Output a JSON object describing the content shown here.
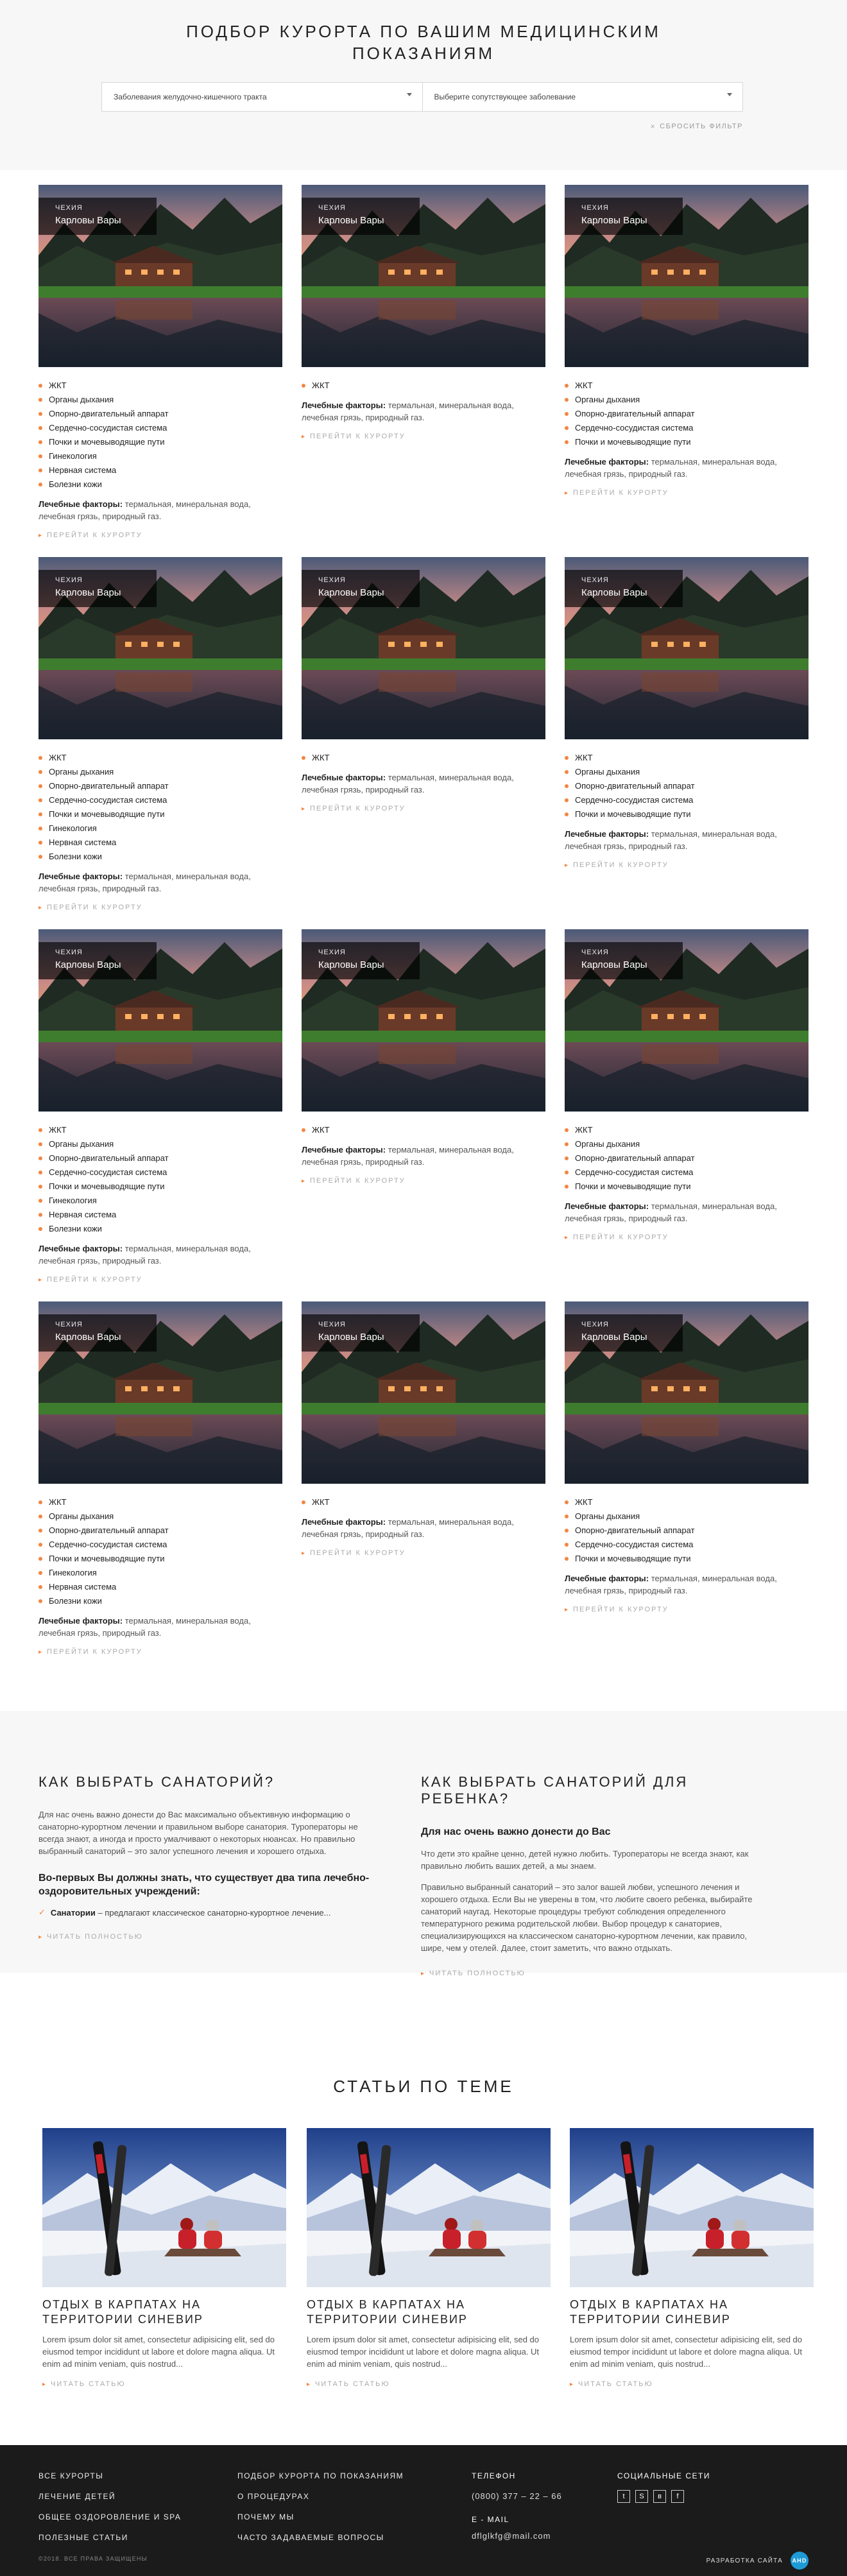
{
  "hero": {
    "title": "ПОДБОР КУРОРТА ПО ВАШИМ МЕДИЦИНСКИМ ПОКАЗАНИЯМ",
    "filter1": "Заболевания желудочно-кишечного тракта",
    "filter2": "Выберите сопутствующее заболевание",
    "reset": "СБРОСИТЬ ФИЛЬТР"
  },
  "cards": [
    {
      "country": "ЧЕХИЯ",
      "name": "Карловы Вары",
      "items": [
        "ЖКТ",
        "Органы дыхания",
        "Опорно-двигательный аппарат",
        "Сердечно-сосудистая система",
        "Почки и мочевыводящие пути",
        "Гинекология",
        "Нервная система",
        "Болезни кожи"
      ],
      "factors_label": "Лечебные факторы:",
      "factors": "термальная, минеральная вода, лечебная грязь, природный газ.",
      "link": "ПЕРЕЙТИ К КУРОРТУ"
    },
    {
      "country": "ЧЕХИЯ",
      "name": "Карловы Вары",
      "items": [
        "ЖКТ"
      ],
      "factors_label": "Лечебные факторы:",
      "factors": "термальная, минеральная вода, лечебная грязь, природный газ.",
      "link": "ПЕРЕЙТИ К КУРОРТУ"
    },
    {
      "country": "ЧЕХИЯ",
      "name": "Карловы Вары",
      "items": [
        "ЖКТ",
        "Органы дыхания",
        "Опорно-двигательный аппарат",
        "Сердечно-сосудистая система",
        "Почки и мочевыводящие пути"
      ],
      "factors_label": "Лечебные факторы:",
      "factors": "термальная, минеральная вода, лечебная грязь, природный газ.",
      "link": "ПЕРЕЙТИ К КУРОРТУ"
    },
    {
      "country": "ЧЕХИЯ",
      "name": "Карловы Вары",
      "items": [
        "ЖКТ",
        "Органы дыхания",
        "Опорно-двигательный аппарат",
        "Сердечно-сосудистая система",
        "Почки и мочевыводящие пути",
        "Гинекология",
        "Нервная система",
        "Болезни кожи"
      ],
      "factors_label": "Лечебные факторы:",
      "factors": "термальная, минеральная вода, лечебная грязь, природный газ.",
      "link": "ПЕРЕЙТИ К КУРОРТУ"
    },
    {
      "country": "ЧЕХИЯ",
      "name": "Карловы Вары",
      "items": [
        "ЖКТ"
      ],
      "factors_label": "Лечебные факторы:",
      "factors": "термальная, минеральная вода, лечебная грязь, природный газ.",
      "link": "ПЕРЕЙТИ К КУРОРТУ"
    },
    {
      "country": "ЧЕХИЯ",
      "name": "Карловы Вары",
      "items": [
        "ЖКТ",
        "Органы дыхания",
        "Опорно-двигательный аппарат",
        "Сердечно-сосудистая система",
        "Почки и мочевыводящие пути"
      ],
      "factors_label": "Лечебные факторы:",
      "factors": "термальная, минеральная вода, лечебная грязь, природный газ.",
      "link": "ПЕРЕЙТИ К КУРОРТУ"
    },
    {
      "country": "ЧЕХИЯ",
      "name": "Карловы Вары",
      "items": [
        "ЖКТ",
        "Органы дыхания",
        "Опорно-двигательный аппарат",
        "Сердечно-сосудистая система",
        "Почки и мочевыводящие пути",
        "Гинекология",
        "Нервная система",
        "Болезни кожи"
      ],
      "factors_label": "Лечебные факторы:",
      "factors": "термальная, минеральная вода, лечебная грязь, природный газ.",
      "link": "ПЕРЕЙТИ К КУРОРТУ"
    },
    {
      "country": "ЧЕХИЯ",
      "name": "Карловы Вары",
      "items": [
        "ЖКТ"
      ],
      "factors_label": "Лечебные факторы:",
      "factors": "термальная, минеральная вода, лечебная грязь, природный газ.",
      "link": "ПЕРЕЙТИ К КУРОРТУ"
    },
    {
      "country": "ЧЕХИЯ",
      "name": "Карловы Вары",
      "items": [
        "ЖКТ",
        "Органы дыхания",
        "Опорно-двигательный аппарат",
        "Сердечно-сосудистая система",
        "Почки и мочевыводящие пути"
      ],
      "factors_label": "Лечебные факторы:",
      "factors": "термальная, минеральная вода, лечебная грязь, природный газ.",
      "link": "ПЕРЕЙТИ К КУРОРТУ"
    },
    {
      "country": "ЧЕХИЯ",
      "name": "Карловы Вары",
      "items": [
        "ЖКТ",
        "Органы дыхания",
        "Опорно-двигательный аппарат",
        "Сердечно-сосудистая система",
        "Почки и мочевыводящие пути",
        "Гинекология",
        "Нервная система",
        "Болезни кожи"
      ],
      "factors_label": "Лечебные факторы:",
      "factors": "термальная, минеральная вода, лечебная грязь, природный газ.",
      "link": "ПЕРЕЙТИ К КУРОРТУ"
    },
    {
      "country": "ЧЕХИЯ",
      "name": "Карловы Вары",
      "items": [
        "ЖКТ"
      ],
      "factors_label": "Лечебные факторы:",
      "factors": "термальная, минеральная вода, лечебная грязь, природный газ.",
      "link": "ПЕРЕЙТИ К КУРОРТУ"
    },
    {
      "country": "ЧЕХИЯ",
      "name": "Карловы Вары",
      "items": [
        "ЖКТ",
        "Органы дыхания",
        "Опорно-двигательный аппарат",
        "Сердечно-сосудистая система",
        "Почки и мочевыводящие пути"
      ],
      "factors_label": "Лечебные факторы:",
      "factors": "термальная, минеральная вода, лечебная грязь, природный газ.",
      "link": "ПЕРЕЙТИ К КУРОРТУ"
    }
  ],
  "info": {
    "left": {
      "title": "КАК ВЫБРАТЬ САНАТОРИЙ?",
      "text": "Для нас очень важно донести до Вас максимально объективную информацию о санаторно-курортном лечении и правильном выборе санатория. Туроператоры не всегда знают, а иногда и просто умалчивают о некоторых нюансах. Но правильно выбранный санаторий – это залог успешного лечения и хорошего отдыха.",
      "subtitle": "Во-первых Вы должны знать, что существует два типа лечебно-оздоровительных учреждений:",
      "item_bold": "Санатории",
      "item_text": "– предлагают классическое санаторно-курортное лечение...",
      "link": "ЧИТАТЬ ПОЛНОСТЬЮ"
    },
    "right": {
      "title": "КАК ВЫБРАТЬ САНАТОРИЙ ДЛЯ РЕБЕНКА?",
      "subtitle": "Для нас очень важно донести до Вас",
      "text1": "Что дети это крайне ценно, детей нужно любить. Туроператоры не всегда знают, как правильно любить ваших детей, а мы знаем.",
      "text2": "Правильно выбранный санаторий – это залог вашей любви, успешного лечения и хорошего отдыха. Если Вы не уверены в том, что любите своего ребенка, выбирайте санаторий наугад. Некоторые процедуры требуют соблюдения определенного температурного режима родительской любви. Выбор процедур к санаториев, специализирующихся на классическом санаторно-курортном лечении, как правило, шире, чем у отелей. Далее, стоит заметить, что важно отдыхать.",
      "link": "ЧИТАТЬ ПОЛНОСТЬЮ"
    }
  },
  "articles": {
    "title": "СТАТЬИ ПО ТЕМЕ",
    "items": [
      {
        "title": "ОТДЫХ В КАРПАТАХ НА ТЕРРИТОРИИ СИНЕВИР",
        "text": "Lorem ipsum dolor sit amet, consectetur adipisicing elit, sed do eiusmod tempor incididunt ut labore et dolore magna aliqua. Ut enim ad minim veniam, quis nostrud...",
        "link": "ЧИТАТЬ СТАТЬЮ"
      },
      {
        "title": "ОТДЫХ В КАРПАТАХ НА ТЕРРИТОРИИ СИНЕВИР",
        "text": "Lorem ipsum dolor sit amet, consectetur adipisicing elit, sed do eiusmod tempor incididunt ut labore et dolore magna aliqua. Ut enim ad minim veniam, quis nostrud...",
        "link": "ЧИТАТЬ СТАТЬЮ"
      },
      {
        "title": "ОТДЫХ В КАРПАТАХ НА ТЕРРИТОРИИ СИНЕВИР",
        "text": "Lorem ipsum dolor sit amet, consectetur adipisicing elit, sed do eiusmod tempor incididunt ut labore et dolore magna aliqua. Ut enim ad minim veniam, quis nostrud...",
        "link": "ЧИТАТЬ СТАТЬЮ"
      }
    ]
  },
  "footer": {
    "col1": [
      "ВСЕ КУРОРТЫ",
      "ЛЕЧЕНИЕ ДЕТЕЙ",
      "ОБЩЕЕ ОЗДОРОВЛЕНИЕ И SPA",
      "ПОЛЕЗНЫЕ СТАТЬИ"
    ],
    "col2": [
      "ПОДБОР КУРОРТА ПО ПОКАЗАНИЯМ",
      "О ПРОЦЕДУРАХ",
      "ПОЧЕМУ МЫ",
      "ЧАСТО ЗАДАВАЕМЫЕ ВОПРОСЫ"
    ],
    "phone_label": "ТЕЛЕФОН",
    "phone": "(0800) 377 – 22 – 66",
    "email_label": "E - MAIL",
    "email": "dflglkfg@mail.com",
    "social_label": "СОЦИАЛЬНЫЕ СЕТИ",
    "social_icons": [
      "twitter-icon",
      "skype-icon",
      "vk-icon",
      "facebook-icon"
    ],
    "social_glyphs": [
      "t",
      "S",
      "в",
      "f"
    ],
    "copyright": "©2018. ВСЕ ПРАВА ЗАЩИЩЕНЫ",
    "dev": "РАЗРАБОТКА САЙТА",
    "dev_logo": "ahd"
  },
  "colors": {
    "accent": "#f5853f",
    "footer_bg": "#1b1b1b",
    "section_bg": "#f7f7f7"
  }
}
